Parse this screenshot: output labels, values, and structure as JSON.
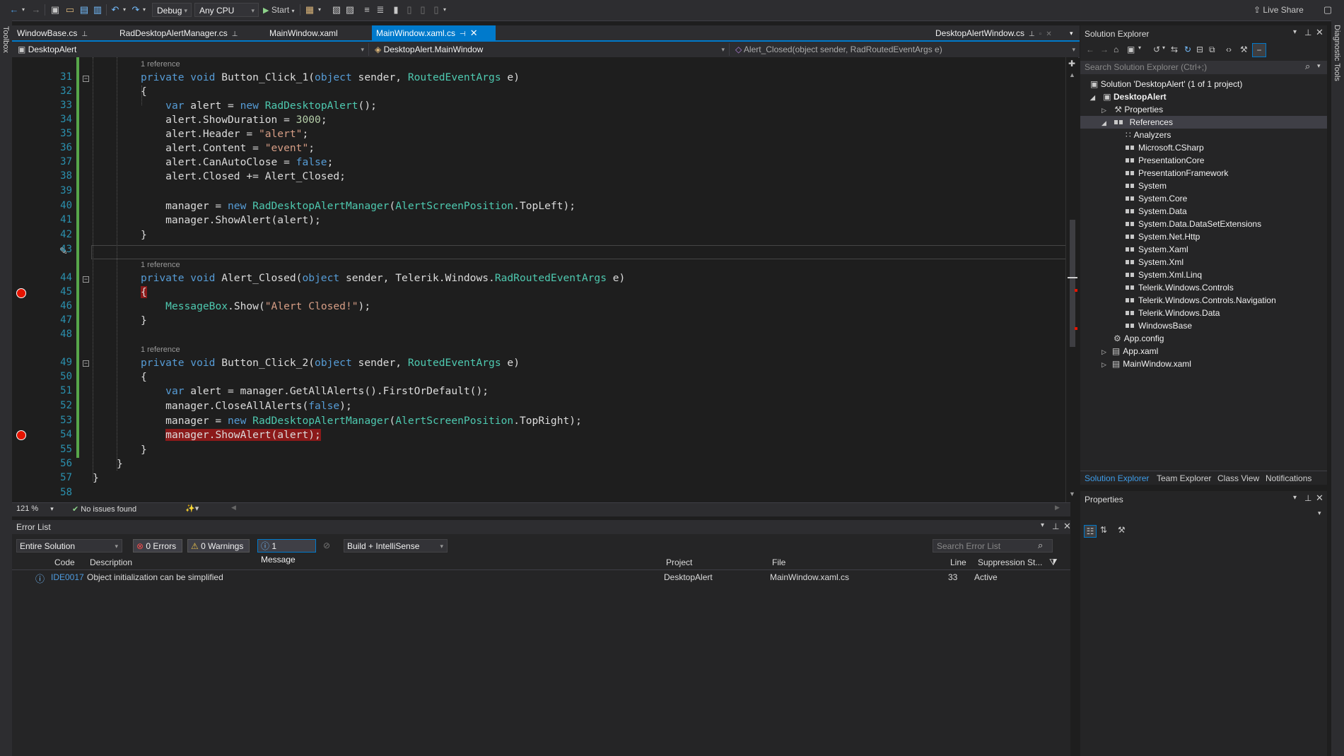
{
  "toolbar": {
    "config": "Debug",
    "platform": "Any CPU",
    "start_label": "Start",
    "live_share": "Live Share"
  },
  "side": {
    "toolbox": "Toolbox",
    "diagnostic": "Diagnostic Tools"
  },
  "tabs": [
    {
      "label": "WindowBase.cs"
    },
    {
      "label": "RadDesktopAlertManager.cs"
    },
    {
      "label": "MainWindow.xaml"
    },
    {
      "label": "MainWindow.xaml.cs"
    },
    {
      "label": "DesktopAlertWindow.cs"
    }
  ],
  "nav": {
    "project": "DesktopAlert",
    "class": "DesktopAlert.MainWindow",
    "member": "Alert_Closed(object sender, RadRoutedEventArgs e)"
  },
  "editor": {
    "ref_label": "1 reference",
    "lines": [
      "31",
      "32",
      "33",
      "34",
      "35",
      "36",
      "37",
      "38",
      "39",
      "40",
      "41",
      "42",
      "43",
      "44",
      "45",
      "46",
      "47",
      "48",
      "49",
      "50",
      "51",
      "52",
      "53",
      "54",
      "55",
      "56",
      "57",
      "58"
    ],
    "zoom": "121 %",
    "issues": "No issues found"
  },
  "errors": {
    "title": "Error List",
    "scope": "Entire Solution",
    "errors_btn": "0 Errors",
    "warnings_btn": "0 Warnings",
    "messages_btn": "1 Message",
    "build_filter": "Build + IntelliSense",
    "search_placeholder": "Search Error List",
    "columns": [
      "Code",
      "Description",
      "Project",
      "File",
      "Line",
      "Suppression St..."
    ],
    "rows": [
      {
        "code": "IDE0017",
        "description": "Object initialization can be simplified",
        "project": "DesktopAlert",
        "file": "MainWindow.xaml.cs",
        "line": "33",
        "suppression": "Active"
      }
    ]
  },
  "solution_explorer": {
    "title": "Solution Explorer",
    "search_placeholder": "Search Solution Explorer (Ctrl+;)",
    "solution": "Solution 'DesktopAlert' (1 of 1 project)",
    "project": "DesktopAlert",
    "properties": "Properties",
    "references": "References",
    "ref_items": [
      "Analyzers",
      "Microsoft.CSharp",
      "PresentationCore",
      "PresentationFramework",
      "System",
      "System.Core",
      "System.Data",
      "System.Data.DataSetExtensions",
      "System.Net.Http",
      "System.Xaml",
      "System.Xml",
      "System.Xml.Linq",
      "Telerik.Windows.Controls",
      "Telerik.Windows.Controls.Navigation",
      "Telerik.Windows.Data",
      "WindowsBase"
    ],
    "files": [
      "App.config",
      "App.xaml",
      "MainWindow.xaml"
    ],
    "bottom_tabs": [
      "Solution Explorer",
      "Team Explorer",
      "Class View",
      "Notifications"
    ]
  },
  "properties_panel": {
    "title": "Properties"
  }
}
